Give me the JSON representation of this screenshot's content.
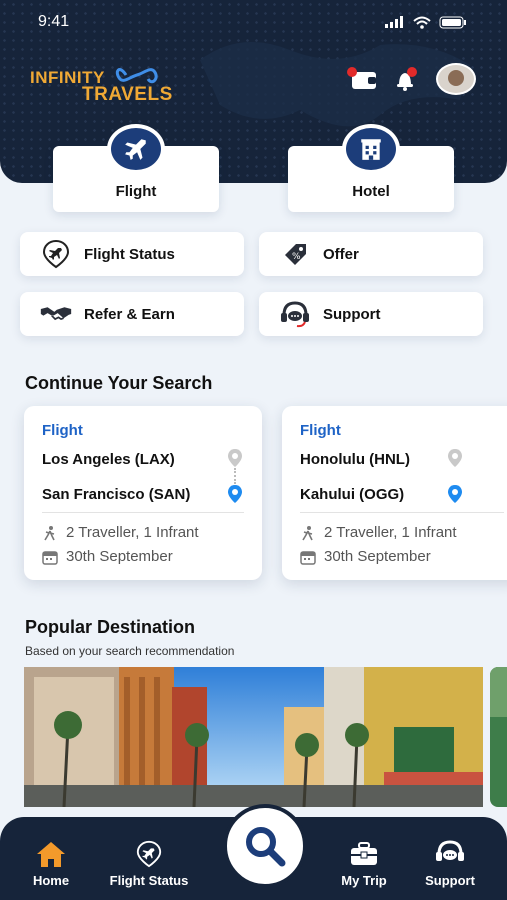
{
  "status_bar": {
    "time": "9:41"
  },
  "brand": {
    "line1": "INFINITY",
    "line2": "TRAVELS"
  },
  "header_icons": [
    "wallet-icon",
    "bell-icon",
    "avatar"
  ],
  "main_tabs": [
    {
      "label": "Flight",
      "icon": "airplane-icon"
    },
    {
      "label": "Hotel",
      "icon": "hotel-icon"
    }
  ],
  "quick_actions": [
    {
      "label": "Flight Status",
      "icon": "flight-status-icon"
    },
    {
      "label": "Offer",
      "icon": "offer-tag-icon"
    },
    {
      "label": "Refer & Earn",
      "icon": "handshake-icon"
    },
    {
      "label": "Support",
      "icon": "headset-icon"
    }
  ],
  "continue_search": {
    "title": "Continue Your Search",
    "cards": [
      {
        "kind": "Flight",
        "from": "Los Angeles (LAX)",
        "to": "San Francisco (SAN)",
        "travellers": "2 Traveller, 1 Infrant",
        "date": "30th September"
      },
      {
        "kind": "Flight",
        "from": "Honolulu (HNL)",
        "to": "Kahului (OGG)",
        "travellers": "2 Traveller, 1 Infrant",
        "date": "30th September"
      }
    ]
  },
  "popular": {
    "title": "Popular Destination",
    "subtitle": "Based on your search recommendation"
  },
  "bottom_nav": [
    {
      "label": "Home",
      "icon": "home-icon",
      "active": true
    },
    {
      "label": "Flight Status",
      "icon": "flight-status-icon"
    },
    {
      "label": "My Trip",
      "icon": "briefcase-icon"
    },
    {
      "label": "Support",
      "icon": "chat-support-icon"
    }
  ],
  "colors": {
    "navy": "#16243a",
    "accent": "#1e63c6",
    "brand_gold": "#f0a935",
    "home_orange": "#f39a2b"
  }
}
